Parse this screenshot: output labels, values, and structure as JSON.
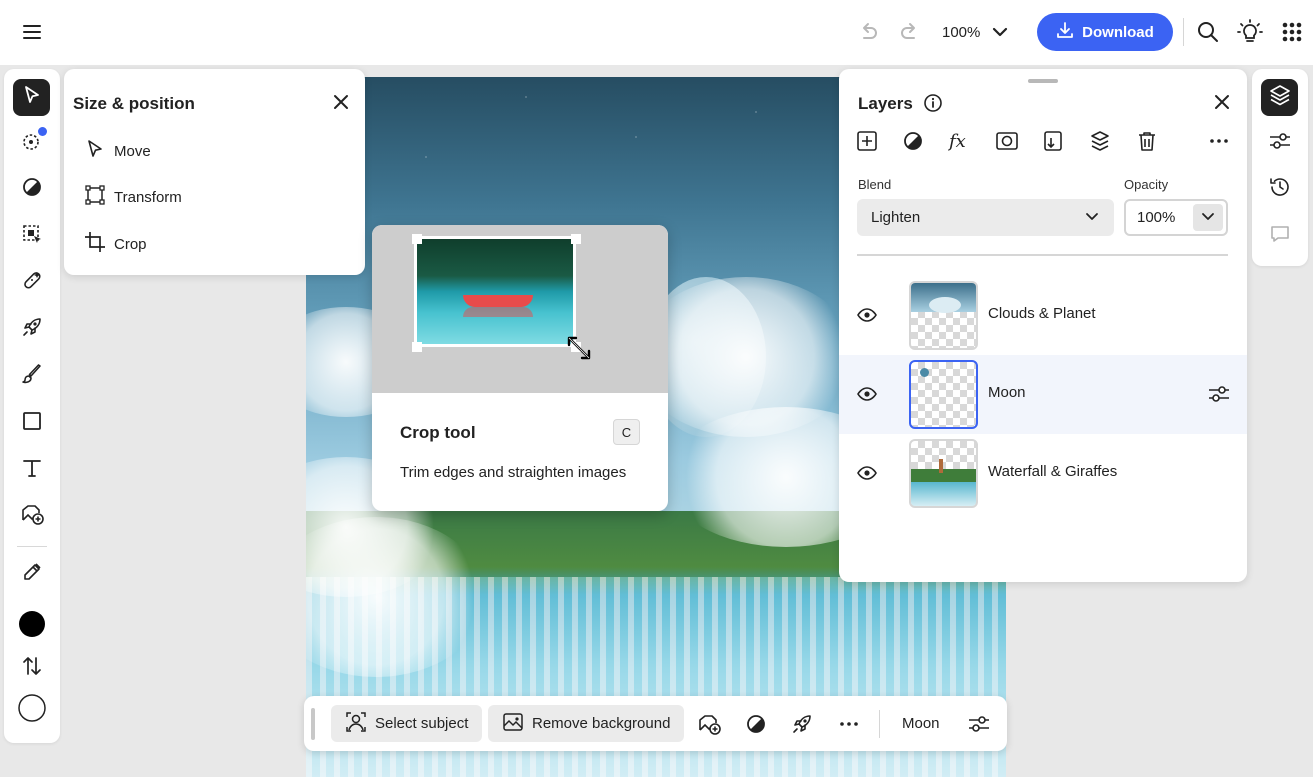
{
  "topbar": {
    "zoom": "100%",
    "download_label": "Download"
  },
  "left_toolbar": {
    "tools": [
      {
        "name": "select",
        "icon": "pointer-icon",
        "active": true
      },
      {
        "name": "quick-selection",
        "icon": "selection-brush-icon",
        "badge": true
      },
      {
        "name": "adjust",
        "icon": "contrast-icon"
      },
      {
        "name": "object-select",
        "icon": "object-select-icon"
      },
      {
        "name": "heal",
        "icon": "bandage-icon"
      },
      {
        "name": "quick-actions",
        "icon": "rocket-icon"
      },
      {
        "name": "brush",
        "icon": "brush-icon"
      },
      {
        "name": "shape",
        "icon": "rectangle-icon"
      },
      {
        "name": "text",
        "icon": "text-icon"
      },
      {
        "name": "add-image",
        "icon": "add-image-icon"
      },
      {
        "name": "eyedropper",
        "icon": "eyedropper-icon"
      },
      {
        "name": "foreground-color",
        "icon": "color-swatch-icon"
      },
      {
        "name": "swap-colors",
        "icon": "swap-arrows-icon"
      },
      {
        "name": "background-color",
        "icon": "color-swatch-icon"
      }
    ]
  },
  "size_panel": {
    "title": "Size & position",
    "items": [
      {
        "label": "Move",
        "icon": "move-pointer-icon"
      },
      {
        "label": "Transform",
        "icon": "transform-icon"
      },
      {
        "label": "Crop",
        "icon": "crop-icon"
      }
    ]
  },
  "tooltip": {
    "title": "Crop tool",
    "shortcut": "C",
    "description": "Trim edges and straighten images"
  },
  "layers_panel": {
    "title": "Layers",
    "blend_label": "Blend",
    "blend_value": "Lighten",
    "opacity_label": "Opacity",
    "opacity_value": "100%",
    "layers": [
      {
        "name": "Clouds & Planet",
        "selected": false
      },
      {
        "name": "Moon",
        "selected": true
      },
      {
        "name": "Waterfall & Giraffes",
        "selected": false
      }
    ]
  },
  "context_bar": {
    "select_subject": "Select subject",
    "remove_background": "Remove background",
    "layer_name": "Moon"
  },
  "colors": {
    "accent": "#3b63f3",
    "foreground_swatch": "#000000",
    "background_swatch": "#ffffff"
  }
}
